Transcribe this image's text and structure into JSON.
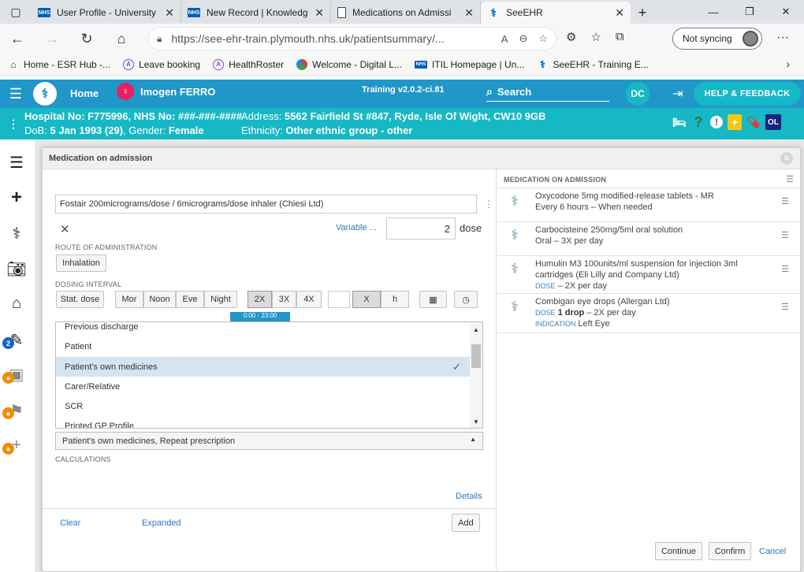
{
  "browser": {
    "tabs": [
      {
        "title": "User Profile - University"
      },
      {
        "title": "New Record | Knowledg"
      },
      {
        "title": "Medications on Admissi"
      },
      {
        "title": "SeeEHR"
      }
    ],
    "url": "https://see-ehr-train.plymouth.nhs.uk/patientsummary/...",
    "sync_label": "Not syncing",
    "favorites": [
      {
        "label": "Home - ESR Hub -..."
      },
      {
        "label": "Leave booking"
      },
      {
        "label": "HealthRoster"
      },
      {
        "label": "Welcome - Digital L..."
      },
      {
        "label": "ITIL Homepage | Un..."
      },
      {
        "label": "SeeEHR - Training E..."
      }
    ]
  },
  "app": {
    "home_label": "Home",
    "patient_name": "Imogen FERRO",
    "environment": "Training v2.0.2-ci.81",
    "search_label": "Search",
    "user_initials": "DC",
    "help_label": "HELP & FEEDBACK",
    "patient_banner": {
      "hospital_no": "Hospital No: F775996, NHS No: ###-###-####",
      "dob_line_prefix": "DoB: ",
      "dob_value": "5 Jan 1993 (29)",
      "gender_prefix": ", Gender: ",
      "gender_value": "Female",
      "address_prefix": "Address: ",
      "address_value": "5562 Fairfield St #847, Ryde, Isle Of Wight, CW10 9GB",
      "ethnicity_prefix": "Ethnicity: ",
      "ethnicity_value": "Other ethnic group - other",
      "ol_badge": "OL"
    },
    "sidebar_badge_count": "2"
  },
  "modal": {
    "title": "Medication on admission",
    "drug_input": "Fostair 200micrograms/dose / 6micrograms/dose inhaler (Chiesi Ltd)",
    "variable_label": "Variable ...",
    "dose_value": "2",
    "dose_unit": "dose",
    "route_label": "ROUTE OF ADMINISTRATION",
    "route_value": "Inhalation",
    "interval_label": "DOSING INTERVAL",
    "interval_buttons": [
      "Stat. dose",
      "Mor",
      "Noon",
      "Eve",
      "Night",
      "2X",
      "3X",
      "4X",
      "X",
      "h"
    ],
    "tooltip_text": "0:00 - 23:00",
    "source_options": [
      "Previous discharge",
      "Patient",
      "Patient's own medicines",
      "Carer/Relative",
      "SCR",
      "Printed GP Profile"
    ],
    "selected_source": "Patient's own medicines",
    "source_select_value": "Patient's own medicines, Repeat prescription",
    "calculations_label": "CALCULATIONS",
    "details_label": "Details",
    "clear_label": "Clear",
    "expanded_label": "Expanded",
    "add_label": "Add",
    "continue_label": "Continue",
    "confirm_label": "Confirm",
    "cancel_label": "Cancel"
  },
  "med_list": {
    "header": "MEDICATION ON ADMISSION",
    "items": [
      {
        "name": "Oxycodone 5mg modified-release tablets - MR",
        "line2": "Every 6 hours – When needed"
      },
      {
        "name": "Carbocisteine 250mg/5ml oral solution",
        "line2": "Oral – 3X per day"
      },
      {
        "name": "Humulin M3 100units/ml suspension for injection 3ml cartridges (Eli Lilly and Company Ltd)",
        "dose_label": "DOSE",
        "dose_value": " – 2X per day"
      },
      {
        "name": "Combigan eye drops (Allergan Ltd)",
        "dose_label": "DOSE",
        "dose_bold": "1 drop",
        "dose_rest": " – 2X per day",
        "indication_label": "INDICATION",
        "indication_value": " Left Eye"
      }
    ]
  },
  "colors": {
    "header_blue": "#2196c9",
    "banner_teal": "#17b8c5",
    "link_blue": "#2b78c2"
  }
}
